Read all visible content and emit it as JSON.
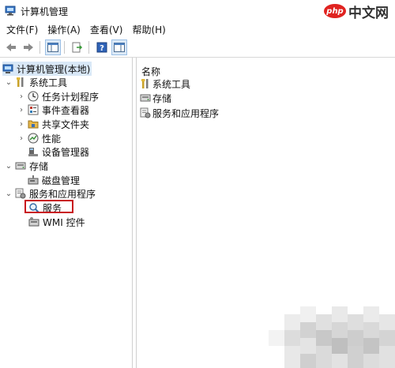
{
  "window": {
    "title": "计算机管理",
    "watermark_logo": "php",
    "watermark_text": "中文网"
  },
  "menu": [
    {
      "label": "文件(F)"
    },
    {
      "label": "操作(A)"
    },
    {
      "label": "查看(V)"
    },
    {
      "label": "帮助(H)"
    }
  ],
  "toolbar": {
    "icons": [
      "back-arrow-icon",
      "forward-arrow-icon",
      "show-hide-tree-icon",
      "export-list-icon",
      "help-icon",
      "properties-icon"
    ]
  },
  "tree": {
    "root": "计算机管理(本地)",
    "system_tools": "系统工具",
    "task_scheduler": "任务计划程序",
    "event_viewer": "事件查看器",
    "shared_folders": "共享文件夹",
    "performance": "性能",
    "device_manager": "设备管理器",
    "storage": "存储",
    "disk_management": "磁盘管理",
    "services_apps": "服务和应用程序",
    "services": "服务",
    "wmi_control": "WMI 控件"
  },
  "list": {
    "column_name": "名称",
    "items": [
      "系统工具",
      "存储",
      "服务和应用程序"
    ]
  },
  "colors": {
    "selection": "#d9e8f7",
    "highlight_border": "#c8151d",
    "watermark_red": "#e02320"
  }
}
